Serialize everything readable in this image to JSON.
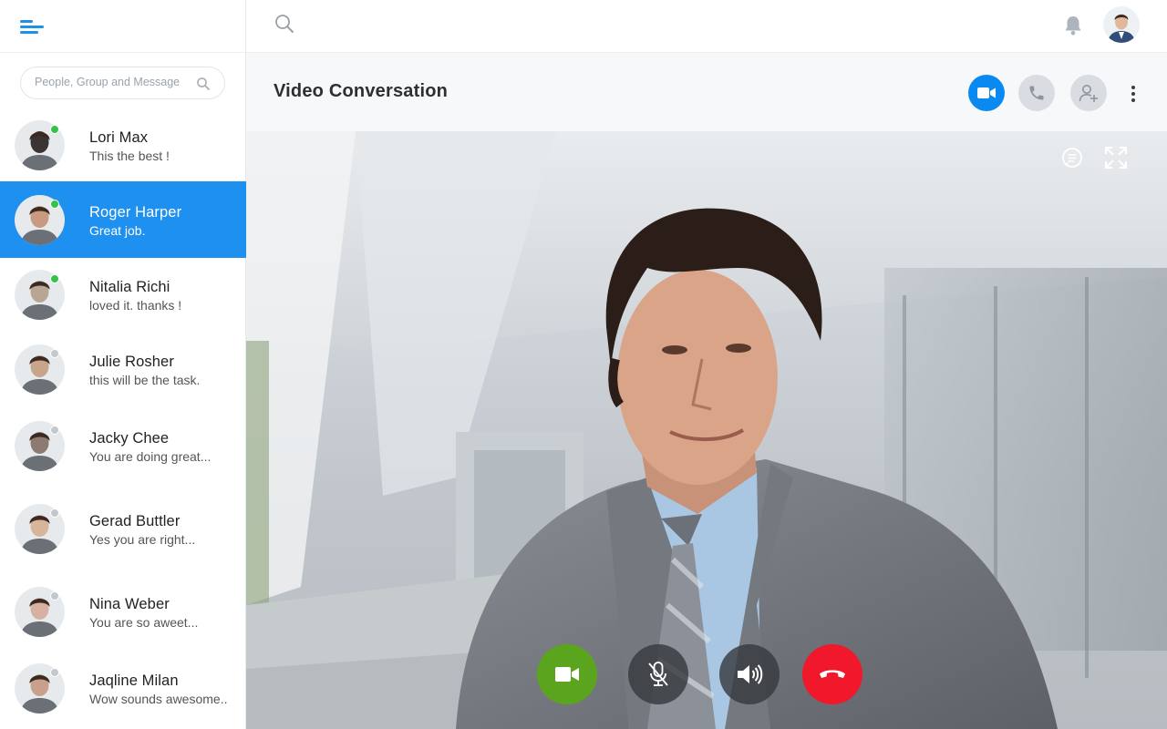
{
  "sidebar": {
    "search_placeholder": "People, Group and Message",
    "contacts": [
      {
        "name": "Lori Max",
        "message": "This the best !",
        "status": "online",
        "avatar_color": "#3a3533"
      },
      {
        "name": "Roger Harper",
        "message": "Great job.",
        "status": "online",
        "avatar_color": "#c99a80"
      },
      {
        "name": "Nitalia Richi",
        "message": "loved it. thanks !",
        "status": "online",
        "avatar_color": "#b9a594"
      },
      {
        "name": "Julie Rosher",
        "message": "this will be the task.",
        "status": "offline",
        "avatar_color": "#c8a48b"
      },
      {
        "name": "Jacky Chee",
        "message": "You are doing great...",
        "status": "offline",
        "avatar_color": "#8d7a70"
      },
      {
        "name": "Gerad Buttler",
        "message": "Yes you are right...",
        "status": "offline",
        "avatar_color": "#d8b49a"
      },
      {
        "name": "Nina Weber",
        "message": "You are so aweet...",
        "status": "offline",
        "avatar_color": "#d6b0a0"
      },
      {
        "name": "Jaqline Milan",
        "message": "Wow sounds awesome..",
        "status": "offline",
        "avatar_color": "#c9a08c"
      }
    ],
    "active_index": 1
  },
  "conversation": {
    "title": "Video Conversation"
  },
  "colors": {
    "accent": "#1e90ef",
    "video_on": "#5aa51d",
    "end_call": "#f0182a",
    "online": "#35c24a"
  },
  "icons": {
    "top": [
      "search-icon",
      "bell-icon",
      "user-avatar"
    ],
    "header": [
      "video-camera-icon",
      "phone-icon",
      "add-user-icon",
      "more-vertical-icon"
    ],
    "stage": [
      "chat-bubble-icon",
      "fullscreen-icon"
    ],
    "controls": [
      "video-camera-icon",
      "mic-off-icon",
      "speaker-icon",
      "end-call-icon"
    ]
  }
}
